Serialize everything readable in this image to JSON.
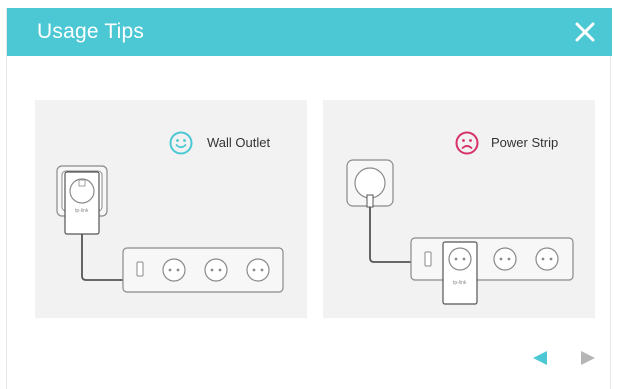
{
  "dialog": {
    "title": "Usage Tips",
    "close_icon": "close-icon",
    "header_color": "#4cc8d5"
  },
  "cards": [
    {
      "label": "Wall Outlet",
      "icon": "smile-icon",
      "icon_color": "#4cc8d5",
      "status": "recommended"
    },
    {
      "label": "Power Strip",
      "icon": "frown-icon",
      "icon_color": "#d6316b",
      "status": "not-recommended"
    }
  ],
  "pagination": {
    "prev_icon": "arrow-left-icon",
    "next_icon": "arrow-right-icon",
    "active_color": "#4cc8d5",
    "inactive_color": "#b5b5b5"
  }
}
